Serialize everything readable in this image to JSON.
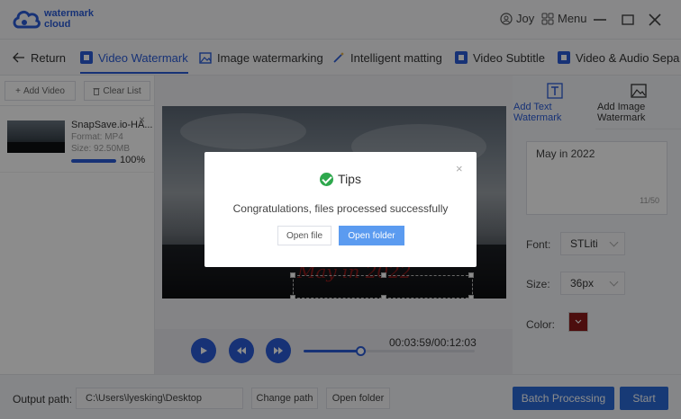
{
  "app": {
    "brand_line1": "watermark",
    "brand_line2": "cloud",
    "user": "Joy",
    "menu": "Menu"
  },
  "tabs": [
    {
      "label": "Return",
      "icon": "arrow-left-icon"
    },
    {
      "label": "Video Watermark",
      "icon": "video-watermark-icon",
      "active": true
    },
    {
      "label": "Image watermarking",
      "icon": "image-icon"
    },
    {
      "label": "Intelligent matting",
      "icon": "magic-wand-icon"
    },
    {
      "label": "Video Subtitle",
      "icon": "subtitle-icon"
    },
    {
      "label": "Video & Audio Sepa",
      "icon": "audio-separate-icon"
    }
  ],
  "left": {
    "add_video": "Add Video",
    "clear_list": "Clear List",
    "file": {
      "name": "SnapSave.io-HA...",
      "format": "Format:  MP4",
      "size": "Size:  92.50MB",
      "progress_label": "100%",
      "progress": 1.0
    }
  },
  "player": {
    "watermark_text": "May in 2022",
    "timecode": "00:03:59/00:12:03",
    "seek_fraction": 0.33
  },
  "right": {
    "tab_text": "Add Text Watermark",
    "tab_text_l1": "Add Text",
    "tab_text_l2": "Watermark",
    "tab_image_l1": "Add Image",
    "tab_image_l2": "Watermark",
    "text_value": "May in 2022",
    "char_count": "11/50",
    "font_label": "Font:",
    "font_value": "STLiti",
    "size_label": "Size:",
    "size_value": "36px",
    "color_label": "Color:",
    "color_value": "#8a1a1a"
  },
  "bottom": {
    "output_label": "Output path:",
    "output_path": "C:\\Users\\lyesking\\Desktop",
    "change_path": "Change path",
    "open_folder": "Open folder",
    "batch": "Batch Processing",
    "start": "Start"
  },
  "modal": {
    "title": "Tips",
    "message": "Congratulations, files processed successfully",
    "open_file": "Open file",
    "open_folder": "Open folder"
  }
}
